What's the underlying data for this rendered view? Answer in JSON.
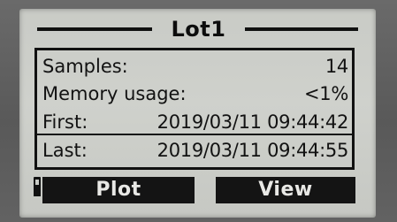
{
  "screen": {
    "title": "Lot1"
  },
  "info": {
    "rows": [
      {
        "label": "Samples:",
        "value": "14"
      },
      {
        "label": "Memory usage:",
        "value": "<1%"
      },
      {
        "label": "First:",
        "value": "2019/03/11 09:44:42"
      },
      {
        "label": "Last:",
        "value": "2019/03/11 09:44:55"
      }
    ]
  },
  "softkeys": {
    "left_label": "Plot",
    "right_label": "View"
  },
  "colors": {
    "lcd_background": "#cacbc6",
    "lcd_ink": "#111111",
    "bezel": "#5e5e5e"
  },
  "icons": {
    "softkey_indicator": "softkey-indicator-icon"
  }
}
